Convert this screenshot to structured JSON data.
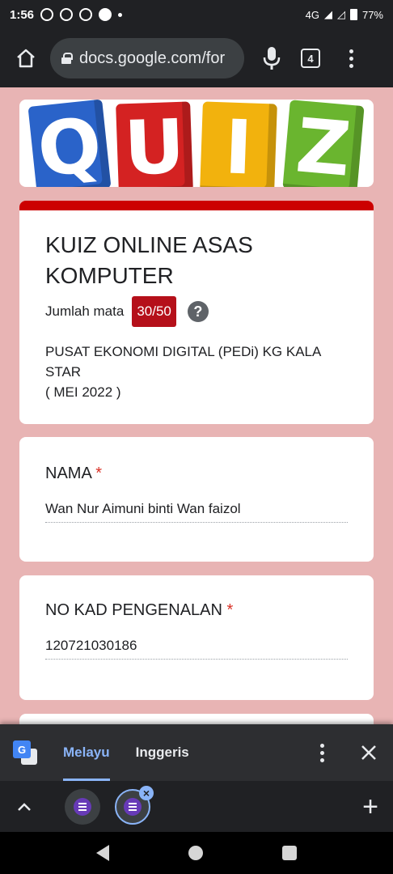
{
  "status_bar": {
    "time": "1:56",
    "network": "4G",
    "battery": "77%"
  },
  "browser": {
    "url": "docs.google.com/for",
    "tab_count": "4"
  },
  "banner": {
    "letters": [
      "Q",
      "U",
      "I",
      "Z"
    ]
  },
  "form": {
    "title": "KUIZ ONLINE ASAS KOMPUTER",
    "score_label": "Jumlah mata",
    "score_value": "30/50",
    "help_symbol": "?",
    "description_line1": "PUSAT EKONOMI DIGITAL (PEDi) KG KALA STAR",
    "description_line2": "( MEI 2022 )"
  },
  "questions": [
    {
      "label": "NAMA",
      "required_mark": "*",
      "answer": "Wan Nur Aimuni binti Wan faizol"
    },
    {
      "label": "NO KAD PENGENALAN",
      "required_mark": "*",
      "answer": "120721030186"
    }
  ],
  "translate_bar": {
    "active_language": "Melayu",
    "other_language": "Inggeris"
  },
  "tab_strip": {
    "close_symbol": "×",
    "plus_symbol": "+"
  }
}
